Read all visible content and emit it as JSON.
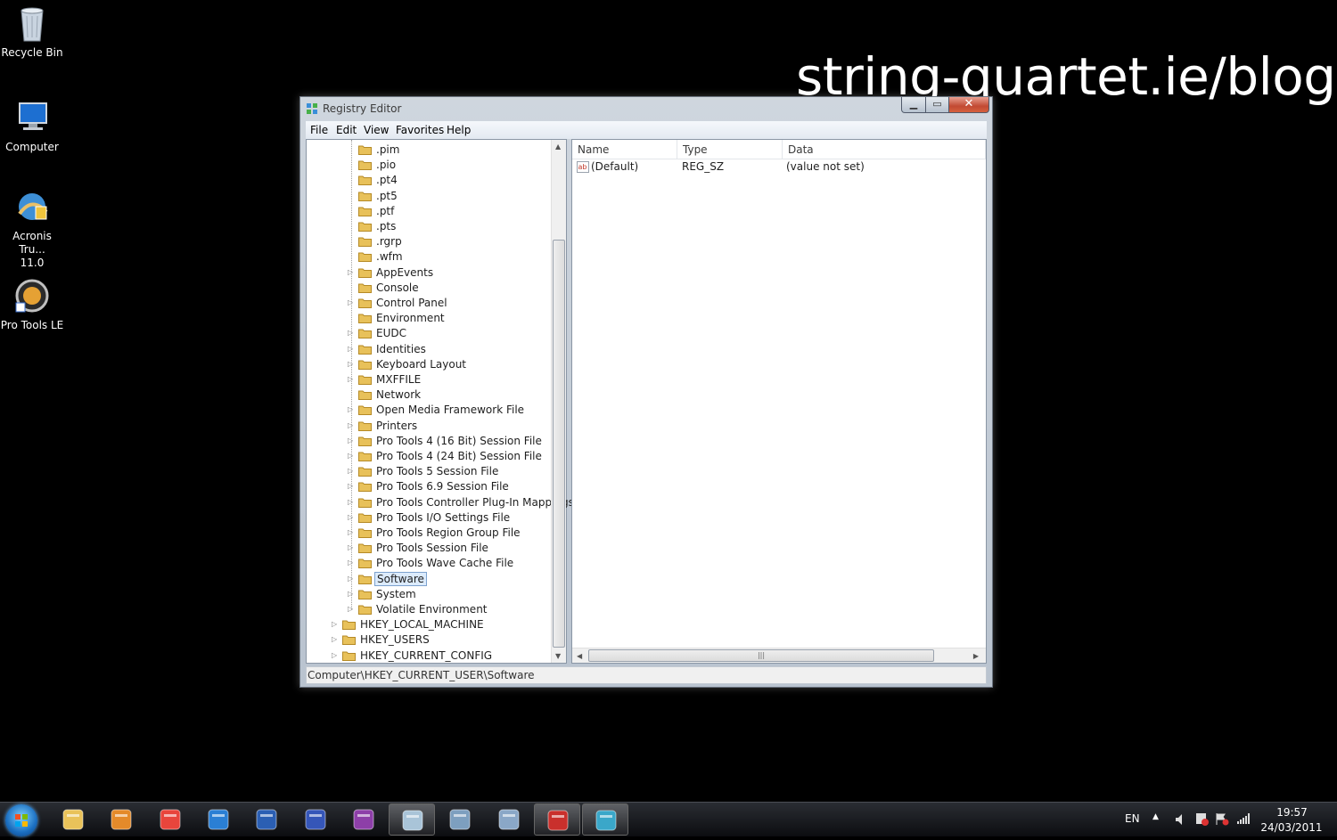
{
  "watermark": "string-quartet.ie/blog",
  "desktop": {
    "icons": [
      {
        "label": "Recycle Bin"
      },
      {
        "label": "Computer"
      },
      {
        "label": "Acronis Tru...",
        "label2": "11.0"
      },
      {
        "label": "Pro Tools LE"
      }
    ]
  },
  "window": {
    "title": "Registry Editor",
    "menu": [
      "File",
      "Edit",
      "View",
      "Favorites",
      "Help"
    ],
    "tree": {
      "items": [
        {
          "label": ".pim",
          "expandable": false
        },
        {
          "label": ".pio",
          "expandable": false
        },
        {
          "label": ".pt4",
          "expandable": false
        },
        {
          "label": ".pt5",
          "expandable": false
        },
        {
          "label": ".ptf",
          "expandable": false
        },
        {
          "label": ".pts",
          "expandable": false
        },
        {
          "label": ".rgrp",
          "expandable": false
        },
        {
          "label": ".wfm",
          "expandable": false
        },
        {
          "label": "AppEvents",
          "expandable": true
        },
        {
          "label": "Console",
          "expandable": false
        },
        {
          "label": "Control Panel",
          "expandable": true
        },
        {
          "label": "Environment",
          "expandable": false
        },
        {
          "label": "EUDC",
          "expandable": true
        },
        {
          "label": "Identities",
          "expandable": true
        },
        {
          "label": "Keyboard Layout",
          "expandable": true
        },
        {
          "label": "MXFFILE",
          "expandable": true
        },
        {
          "label": "Network",
          "expandable": false
        },
        {
          "label": "Open Media Framework File",
          "expandable": true
        },
        {
          "label": "Printers",
          "expandable": true
        },
        {
          "label": "Pro Tools 4 (16 Bit) Session File",
          "expandable": true
        },
        {
          "label": "Pro Tools 4 (24 Bit) Session File",
          "expandable": true
        },
        {
          "label": "Pro Tools 5 Session File",
          "expandable": true
        },
        {
          "label": "Pro Tools 6.9 Session File",
          "expandable": true
        },
        {
          "label": "Pro Tools Controller Plug-In Mappings",
          "expandable": true
        },
        {
          "label": "Pro Tools I/O Settings File",
          "expandable": true
        },
        {
          "label": "Pro Tools Region Group File",
          "expandable": true
        },
        {
          "label": "Pro Tools Session File",
          "expandable": true
        },
        {
          "label": "Pro Tools Wave Cache File",
          "expandable": true
        },
        {
          "label": "Software",
          "expandable": true,
          "selected": true
        },
        {
          "label": "System",
          "expandable": true
        },
        {
          "label": "Volatile Environment",
          "expandable": true
        }
      ],
      "roots": [
        {
          "label": "HKEY_LOCAL_MACHINE"
        },
        {
          "label": "HKEY_USERS"
        },
        {
          "label": "HKEY_CURRENT_CONFIG"
        }
      ]
    },
    "list": {
      "columns": [
        "Name",
        "Type",
        "Data"
      ],
      "rows": [
        {
          "name": "(Default)",
          "type": "REG_SZ",
          "data": "(value not set)"
        }
      ]
    },
    "status": "Computer\\HKEY_CURRENT_USER\\Software"
  },
  "taskbar": {
    "apps": [
      "windows-explorer",
      "media-player",
      "chrome",
      "internet-explorer",
      "word",
      "save-disk",
      "onenote",
      "pen-tool",
      "calculator",
      "file-manager",
      "acrobat",
      "registry-editor"
    ],
    "active": [
      7,
      10,
      11
    ],
    "language": "EN",
    "clock_time": "19:57",
    "clock_date": "24/03/2011"
  },
  "colors": {
    "accent_selection": "#dcebfc",
    "close_button": "#c24a33",
    "folder": "#e8c15a"
  }
}
